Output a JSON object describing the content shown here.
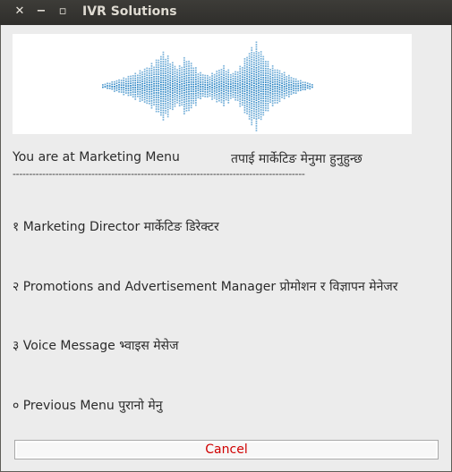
{
  "window": {
    "title": "IVR Solutions",
    "close_glyph": "✕",
    "minimize_glyph": "−",
    "maximize_glyph": "▫"
  },
  "banner": {
    "icon": "sound-wave-icon",
    "color": "#1a7bbf"
  },
  "menu": {
    "heading_en": "You are at Marketing Menu",
    "heading_np": "तपाई मार्केटिङ मेनुमा हुनुहुन्छ",
    "divider": "-----------------------------------------------------------------------------------------",
    "items": [
      {
        "text": "१  Marketing Director  मार्केटिङ डिरेक्टर"
      },
      {
        "text": "२ Promotions and Advertisement Manager   प्रोमोशन र विज्ञापन मेनेजर"
      },
      {
        "text": "३ Voice Message   भ्वाइस मेसेज"
      },
      {
        "text": "०   Previous Menu   पुरानो मेनु"
      }
    ]
  },
  "cancel_label": "Cancel",
  "colors": {
    "cancel_text": "#d00000",
    "titlebar": "#3a3935"
  }
}
